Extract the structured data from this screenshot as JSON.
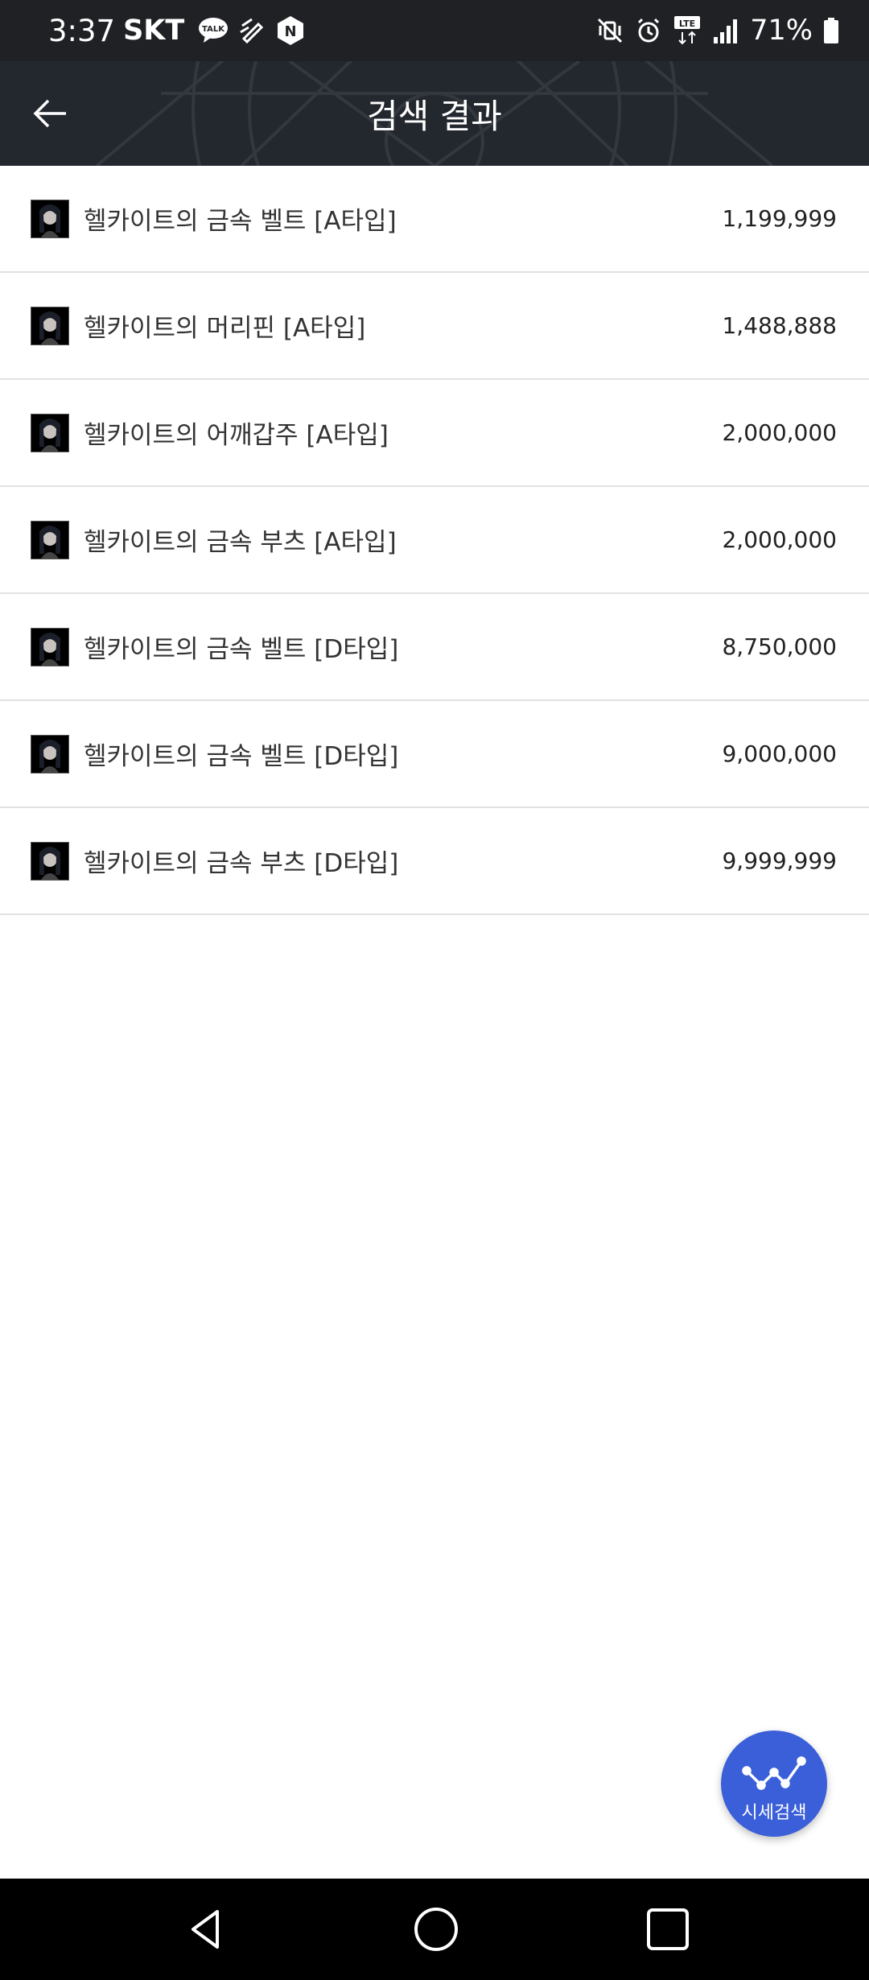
{
  "status_bar": {
    "time": "3:37",
    "carrier": "SKT",
    "talk_badge": "TALK",
    "n_badge": "N",
    "lte_badge": "LTE",
    "battery_percent": "71%"
  },
  "header": {
    "title": "검색 결과",
    "back_icon": "arrow-left-icon"
  },
  "results": [
    {
      "name": "헬카이트의 금속 벨트 [A타입]",
      "price": "1,199,999"
    },
    {
      "name": "헬카이트의 머리핀 [A타입]",
      "price": "1,488,888"
    },
    {
      "name": "헬카이트의 어깨갑주 [A타입]",
      "price": "2,000,000"
    },
    {
      "name": "헬카이트의 금속 부츠 [A타입]",
      "price": "2,000,000"
    },
    {
      "name": "헬카이트의 금속 벨트 [D타입]",
      "price": "8,750,000"
    },
    {
      "name": "헬카이트의 금속 벨트 [D타입]",
      "price": "9,000,000"
    },
    {
      "name": "헬카이트의 금속 부츠 [D타입]",
      "price": "9,999,999"
    }
  ],
  "fab": {
    "label": "시세검색",
    "icon": "trend-chart-icon",
    "color": "#3a5fd9"
  },
  "nav_bar": {
    "back_icon": "triangle-back-icon",
    "home_icon": "circle-home-icon",
    "recents_icon": "square-recents-icon"
  },
  "colors": {
    "status_bar_bg": "#1f2125",
    "app_bar_bg": "#23272e",
    "divider": "#e2e2e2",
    "nav_bar_bg": "#000000"
  }
}
